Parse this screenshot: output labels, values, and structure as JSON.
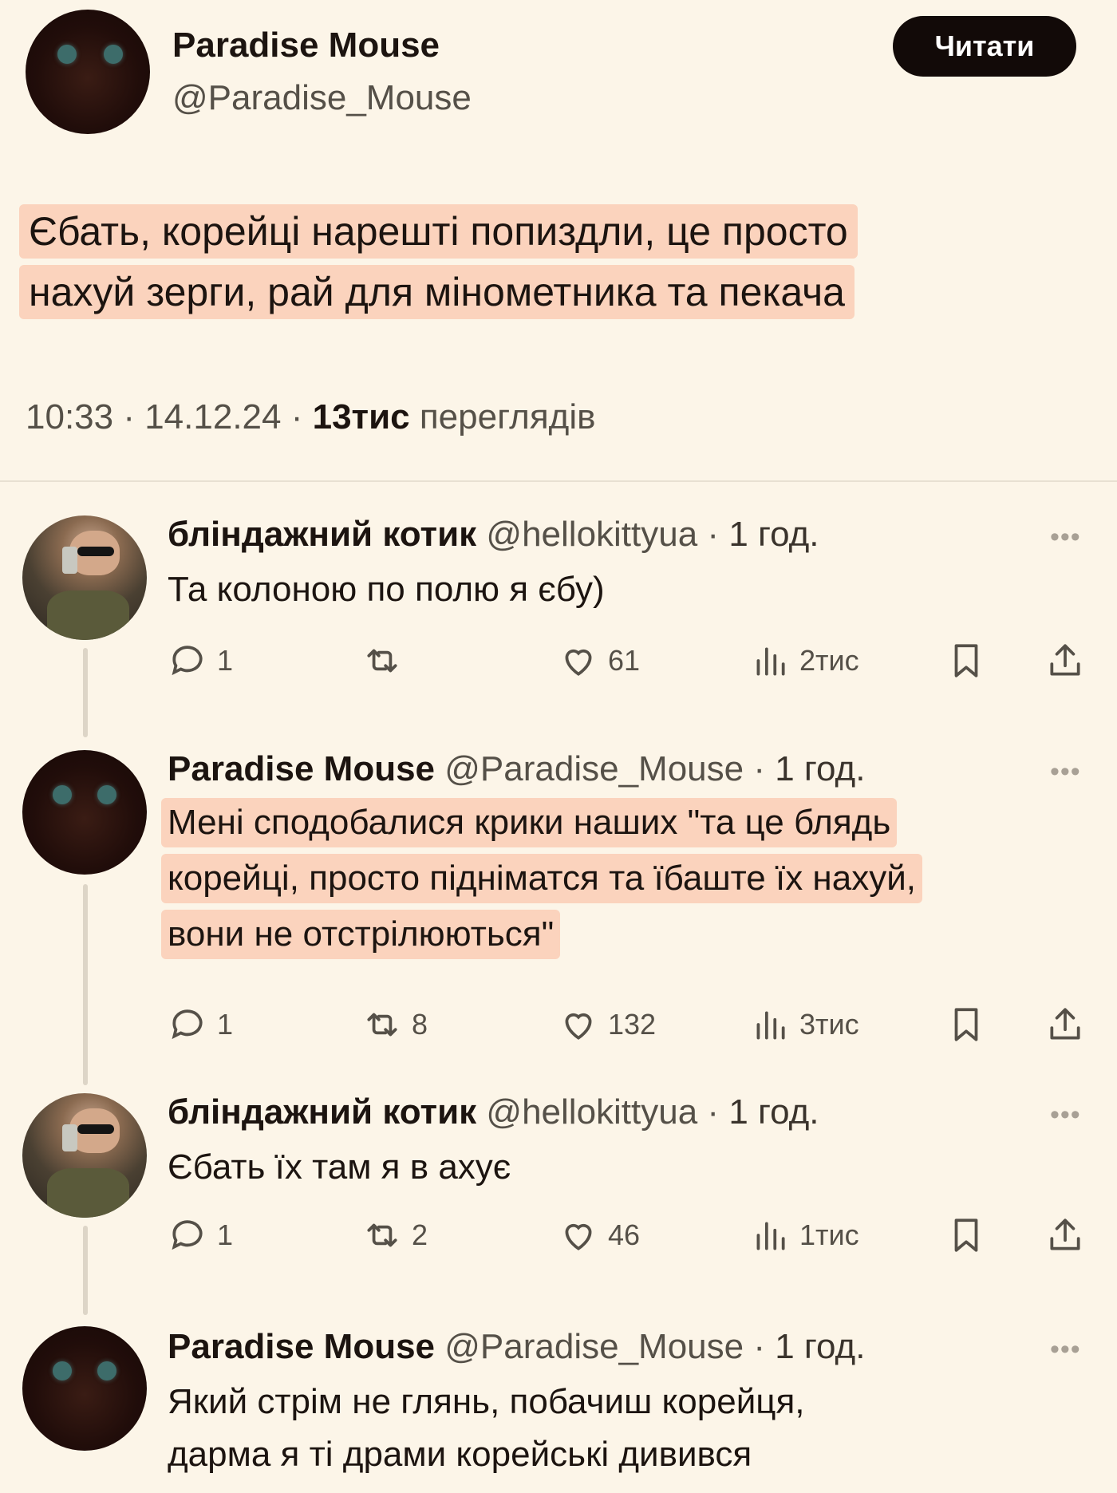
{
  "op": {
    "name": "Paradise Mouse",
    "handle": "@Paradise_Mouse",
    "follow_label": "Читати",
    "text_lines": [
      "Єбать, корейці нарешті попиздли, це просто",
      "нахуй зерги, рай для мінометника та пекача"
    ],
    "time": "10:33 · 14.12.24 · ",
    "views_count": "13тис",
    "views_label": " переглядів"
  },
  "replies": [
    {
      "name": "бліндажний котик",
      "handle": "@hellokittyua",
      "time": "1 год.",
      "lines": [
        "Та колоною по полю я єбу)"
      ],
      "replies_count": "1",
      "reposts_count": "",
      "likes_count": "61",
      "views_count": "2тис"
    },
    {
      "name": "Paradise Mouse",
      "handle": "@Paradise_Mouse",
      "time": "1 год.",
      "lines": [
        "Мені сподобалися крики наших \"та це блядь",
        "корейці, просто піднiматся та їбаште їх нахуй,",
        "вони не отстрілюються\""
      ],
      "replies_count": "1",
      "reposts_count": "8",
      "likes_count": "132",
      "views_count": "3тис"
    },
    {
      "name": "бліндажний котик",
      "handle": "@hellokittyua",
      "time": "1 год.",
      "lines": [
        "Єбать їх там я в ахує"
      ],
      "replies_count": "1",
      "reposts_count": "2",
      "likes_count": "46",
      "views_count": "1тис"
    },
    {
      "name": "Paradise Mouse",
      "handle": "@Paradise_Mouse",
      "time": "1 год.",
      "lines": [
        "Який стрім не глянь, побачиш корейця,",
        "дарма я ті драми корейські дивився"
      ]
    }
  ],
  "more_glyph": "•••",
  "dot_sep": " · ",
  "colors": {
    "background": "#fcf5e8",
    "highlight": "#fbd3bd",
    "button": "#120a08",
    "muted": "#555048"
  },
  "icons": [
    "reply-icon",
    "repost-icon",
    "like-icon",
    "views-icon",
    "bookmark-icon",
    "share-icon",
    "more-icon"
  ]
}
